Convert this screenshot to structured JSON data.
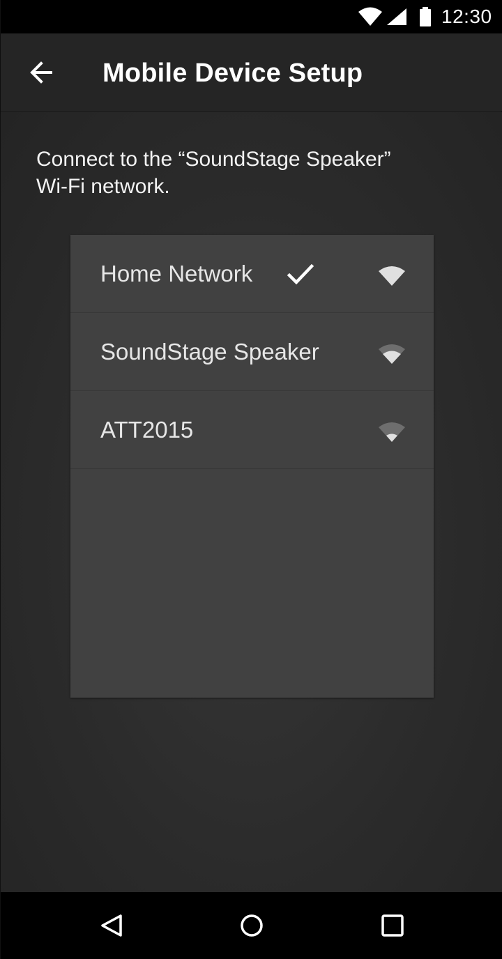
{
  "status_bar": {
    "time": "12:30",
    "icons": [
      "wifi-full-icon",
      "cell-signal-icon",
      "battery-icon"
    ]
  },
  "app_bar": {
    "back_icon": "arrow-back-icon",
    "title": "Mobile Device Setup"
  },
  "content": {
    "instruction_line1": "Connect to the “SoundStage Speaker”",
    "instruction_line2": "Wi-Fi network."
  },
  "networks": [
    {
      "name": "Home Network",
      "connected": true,
      "signal_bars": 4
    },
    {
      "name": "SoundStage Speaker",
      "connected": false,
      "signal_bars": 3
    },
    {
      "name": "ATT2015",
      "connected": false,
      "signal_bars": 2
    }
  ],
  "nav_bar": {
    "icons": [
      "nav-back-icon",
      "nav-home-icon",
      "nav-recents-icon"
    ]
  },
  "colors": {
    "background": "#2a2a2a",
    "card": "#414141",
    "app_bar": "#252525",
    "text": "#ffffff",
    "wifi_filled": "#e0e0e0",
    "wifi_dim": "#6e6e6e"
  }
}
